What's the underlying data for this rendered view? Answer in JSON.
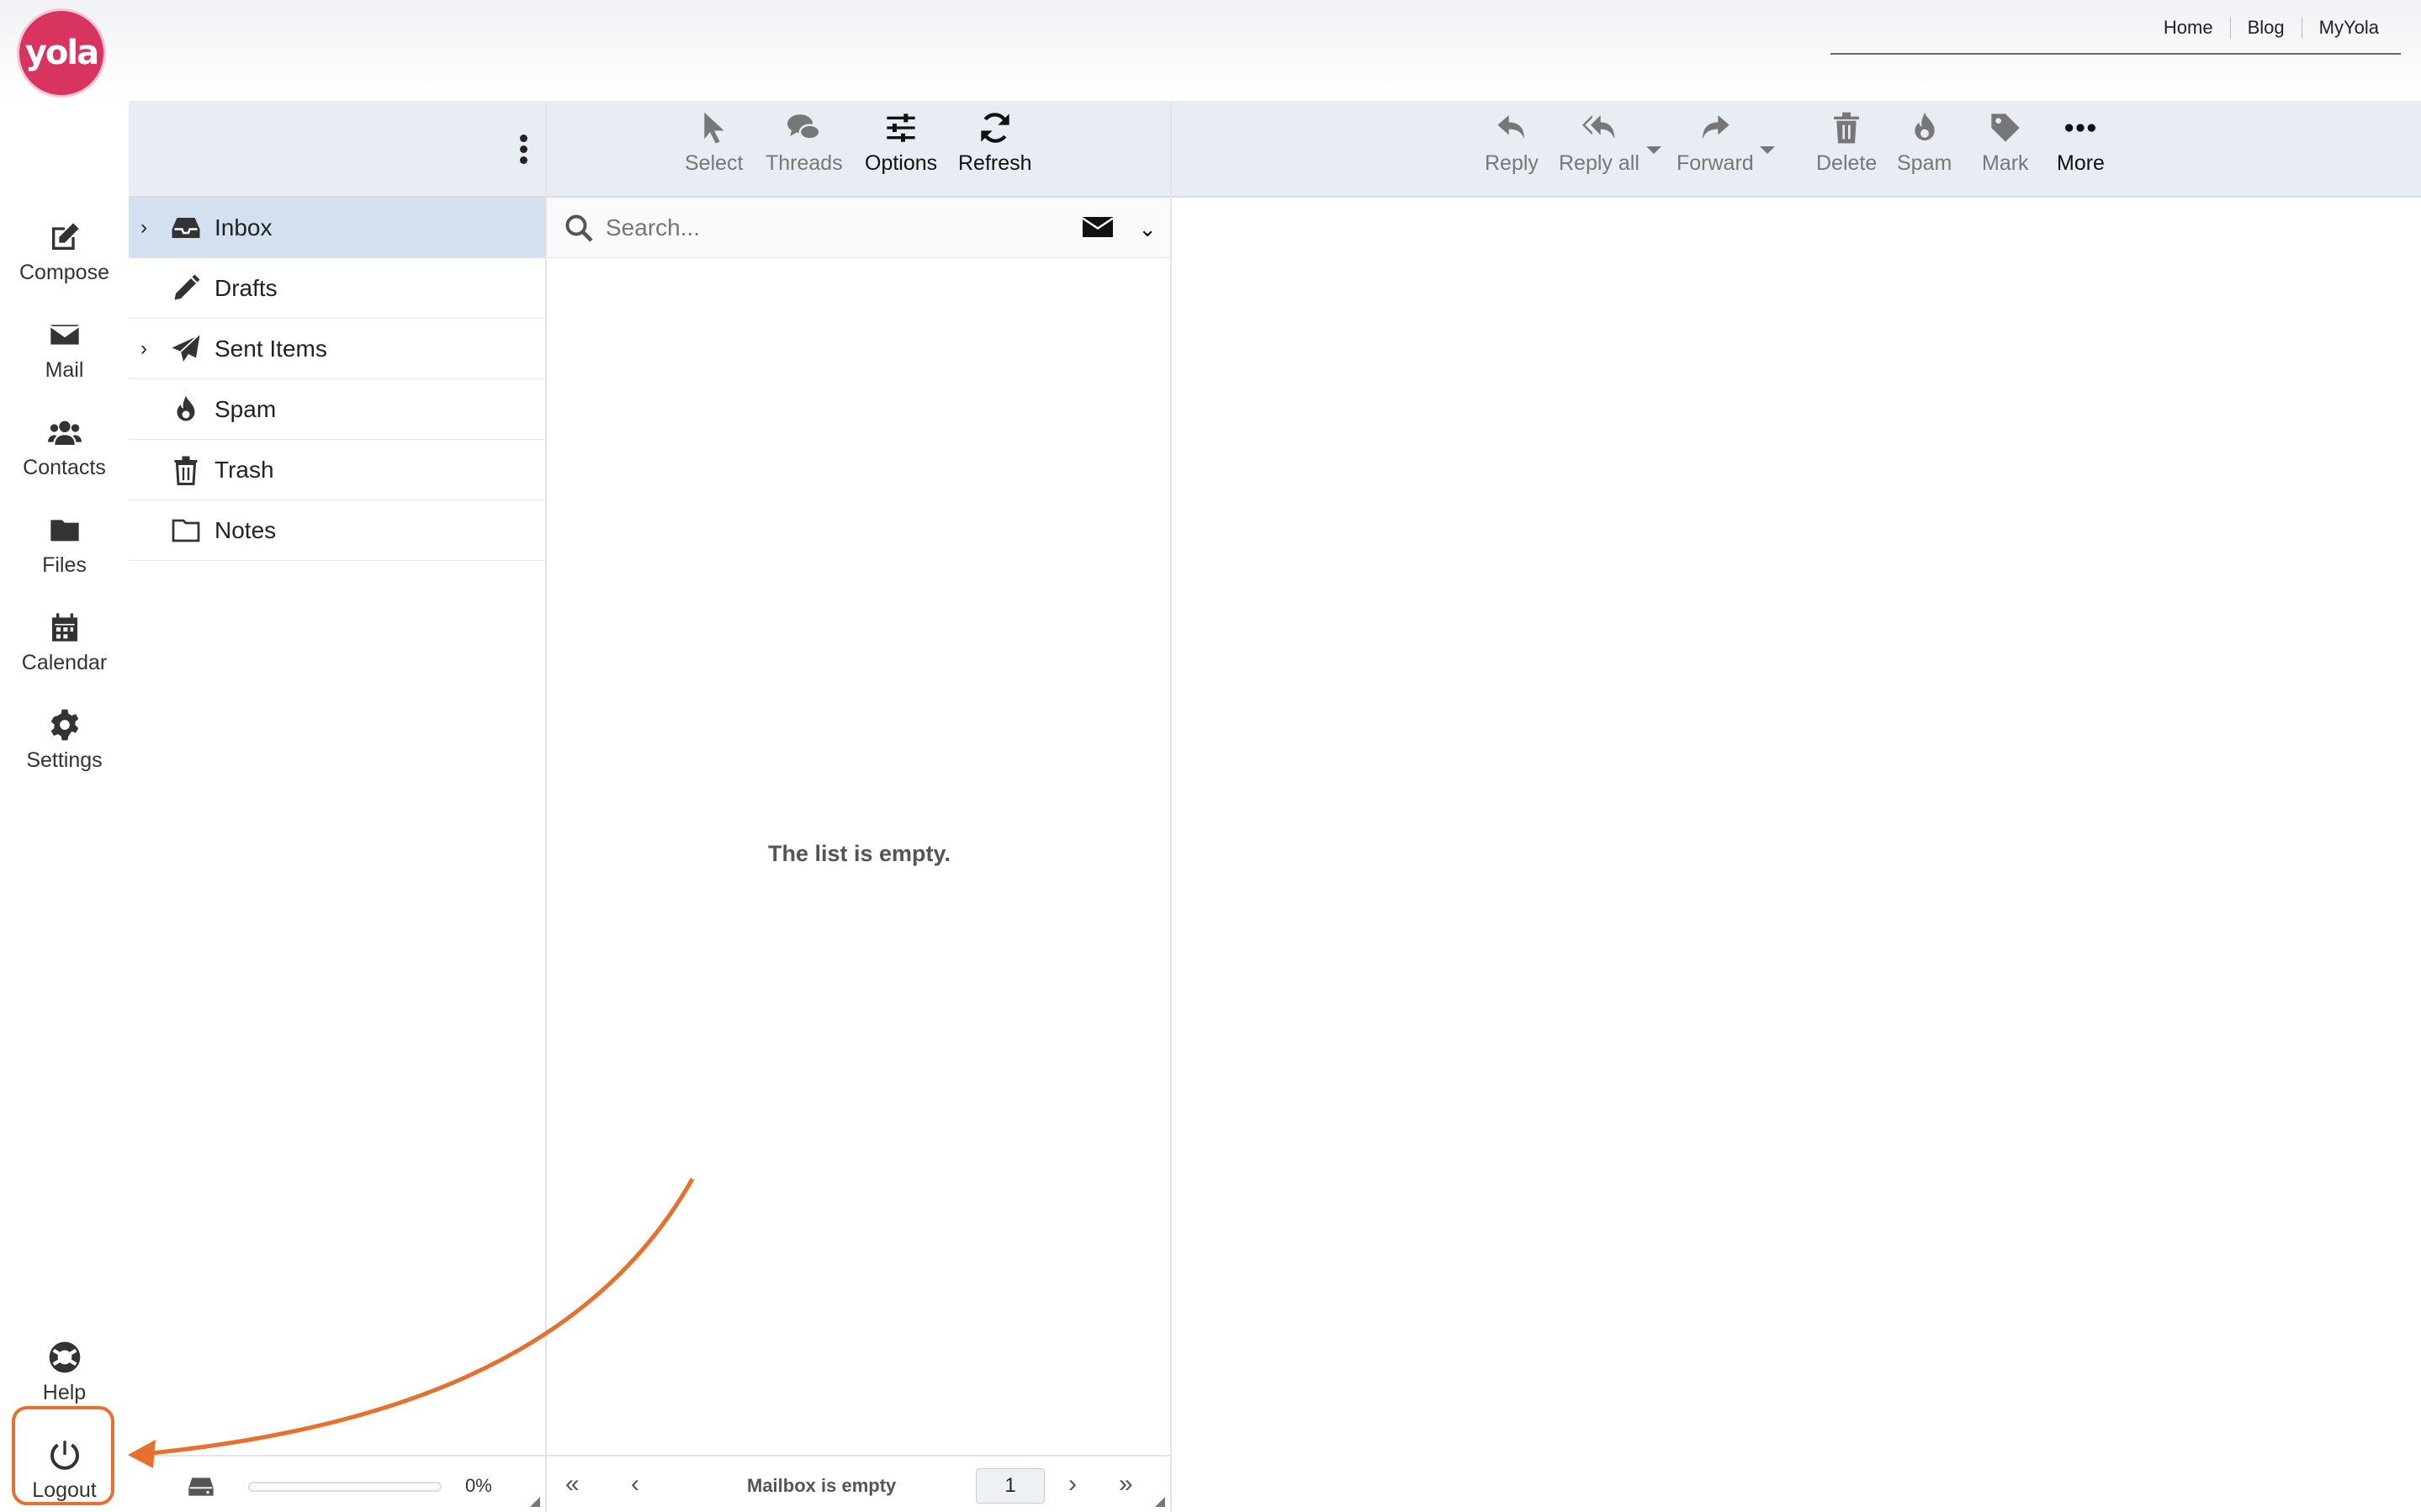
{
  "header": {
    "logo_text": "yola",
    "links": [
      "Home",
      "Blog",
      "MyYola"
    ]
  },
  "nav": {
    "compose": "Compose",
    "mail": "Mail",
    "contacts": "Contacts",
    "files": "Files",
    "calendar": "Calendar",
    "settings": "Settings",
    "help": "Help",
    "logout": "Logout"
  },
  "folders": [
    {
      "label": "Inbox",
      "icon": "inbox-icon",
      "expandable": true,
      "active": true
    },
    {
      "label": "Drafts",
      "icon": "pencil-icon",
      "expandable": false
    },
    {
      "label": "Sent Items",
      "icon": "paper-plane-icon",
      "expandable": true
    },
    {
      "label": "Spam",
      "icon": "fire-icon",
      "expandable": false
    },
    {
      "label": "Trash",
      "icon": "trash-icon",
      "expandable": false
    },
    {
      "label": "Notes",
      "icon": "folder-icon",
      "expandable": false
    }
  ],
  "quota": {
    "percent_label": "0%",
    "fraction": 0
  },
  "list_toolbar": {
    "select": "Select",
    "threads": "Threads",
    "options": "Options",
    "refresh": "Refresh"
  },
  "search": {
    "placeholder": "Search..."
  },
  "list": {
    "empty_message": "The list is empty.",
    "footer_status": "Mailbox is empty",
    "page": "1"
  },
  "read_toolbar": {
    "reply": "Reply",
    "reply_all": "Reply all",
    "forward": "Forward",
    "delete": "Delete",
    "spam": "Spam",
    "mark": "Mark",
    "more": "More"
  },
  "colors": {
    "brand": "#d8345f",
    "annotation": "#e8702f",
    "active_folder": "#d2e0f0",
    "toolbar_bg": "#e8edf3"
  }
}
